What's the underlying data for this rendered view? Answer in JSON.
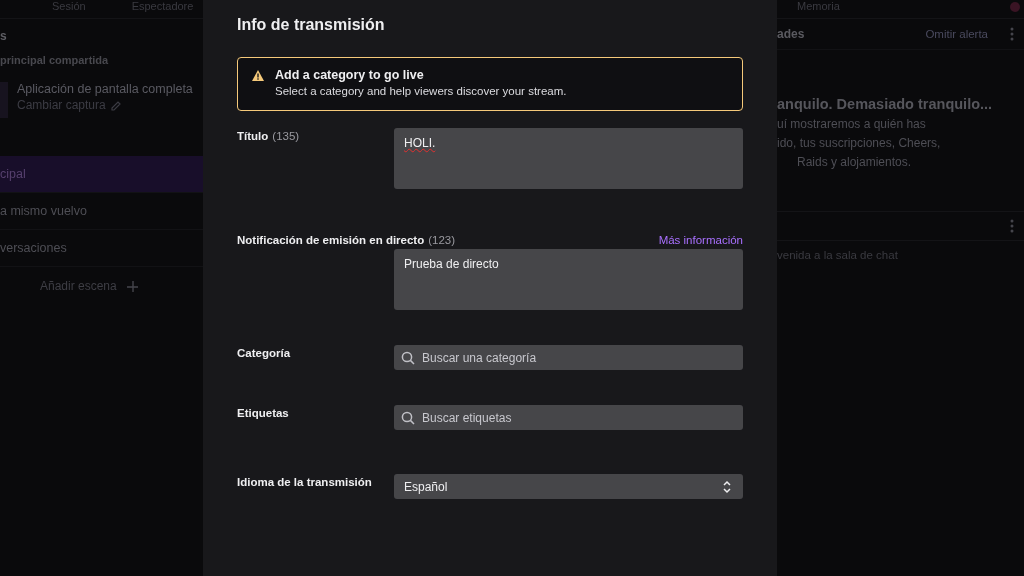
{
  "background": {
    "top_tabs": [
      {
        "label": "Sesión"
      },
      {
        "label": "Espectadore"
      },
      {
        "label": "Memoria"
      }
    ],
    "left_panel": {
      "header": "s",
      "source_group": "principal compartida",
      "source_name": "Aplicación de pantalla completa",
      "source_action": "Cambiar captura",
      "scenes": [
        {
          "label": "cipal",
          "selected": true
        },
        {
          "label": "a mismo vuelvo",
          "selected": false
        },
        {
          "label": "versaciones",
          "selected": false
        }
      ],
      "add_scene": "Añadir escena"
    },
    "right_panel": {
      "header": "ades",
      "dismiss": "Omitir alerta",
      "empty_title": "anquilo. Demasiado tranquilo...",
      "empty_lines": [
        "uí mostraremos a quién has",
        "ido, tus suscripciones, Cheers,",
        "Raids y alojamientos."
      ],
      "chat_welcome": "venida a la sala de chat"
    }
  },
  "modal": {
    "title": "Info de transmisión",
    "alert": {
      "title": "Add a category to go live",
      "message": "Select a category and help viewers discover your stream."
    },
    "fields": [
      {
        "kind": "textarea",
        "label": "Título",
        "count": "(135)",
        "value": "HOLI.",
        "misspelled": true
      },
      {
        "kind": "textarea",
        "label": "Notificación de emisión en directo",
        "count": "(123)",
        "link": "Más información",
        "value": "Prueba de directo",
        "misspelled": false
      },
      {
        "kind": "search",
        "label": "Categoría",
        "placeholder": "Buscar una categoría"
      },
      {
        "kind": "search",
        "label": "Etiquetas",
        "placeholder": "Buscar etiquetas"
      },
      {
        "kind": "select",
        "label": "Idioma de la transmisión",
        "value": "Español"
      }
    ]
  }
}
